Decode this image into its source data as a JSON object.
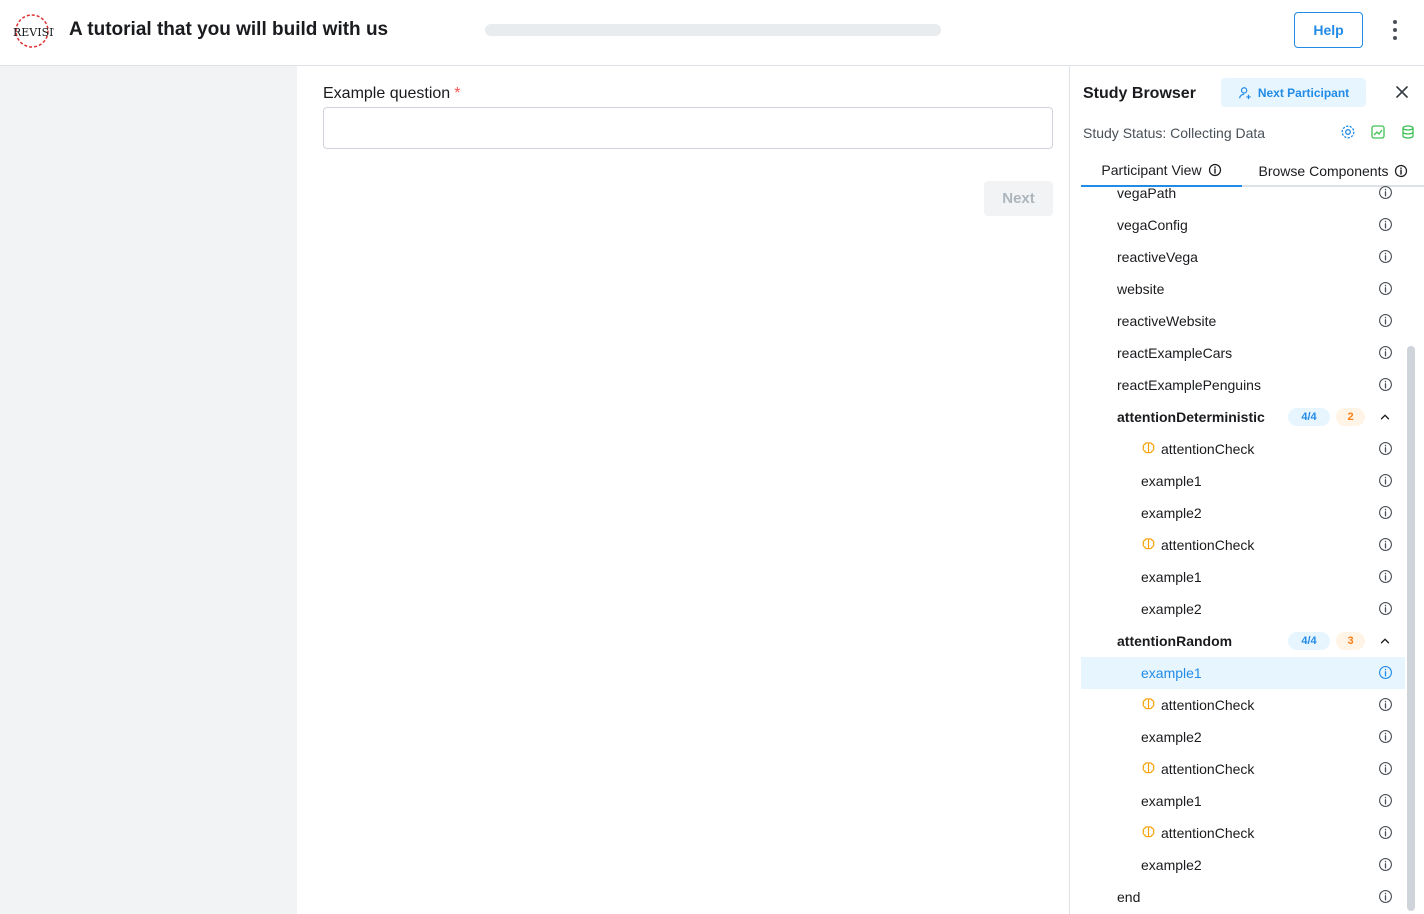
{
  "header": {
    "title": "A tutorial that you will build with us",
    "progress_percent": 0,
    "help_label": "Help"
  },
  "question": {
    "label": "Example question",
    "required_mark": "*",
    "value": "",
    "next_label": "Next"
  },
  "sidebar": {
    "title": "Study Browser",
    "next_participant_label": "Next Participant",
    "status_text": "Study Status: Collecting Data",
    "tabs": [
      {
        "label": "Participant View"
      },
      {
        "label": "Browse Components"
      }
    ],
    "tree": [
      {
        "label": "vegaPath",
        "level": 1
      },
      {
        "label": "vegaConfig",
        "level": 1
      },
      {
        "label": "reactiveVega",
        "level": 1
      },
      {
        "label": "website",
        "level": 1
      },
      {
        "label": "reactiveWebsite",
        "level": 1
      },
      {
        "label": "reactExampleCars",
        "level": 1
      },
      {
        "label": "reactExamplePenguins",
        "level": 1
      },
      {
        "label": "attentionDeterministic",
        "level": 1,
        "group": true,
        "badge_count": "4/4",
        "badge_order": "2"
      },
      {
        "label": "attentionCheck",
        "level": 2,
        "brain": true
      },
      {
        "label": "example1",
        "level": 2
      },
      {
        "label": "example2",
        "level": 2
      },
      {
        "label": "attentionCheck",
        "level": 2,
        "brain": true
      },
      {
        "label": "example1",
        "level": 2
      },
      {
        "label": "example2",
        "level": 2
      },
      {
        "label": "attentionRandom",
        "level": 1,
        "group": true,
        "badge_count": "4/4",
        "badge_order": "3"
      },
      {
        "label": "example1",
        "level": 2,
        "selected": true
      },
      {
        "label": "attentionCheck",
        "level": 2,
        "brain": true
      },
      {
        "label": "example2",
        "level": 2
      },
      {
        "label": "attentionCheck",
        "level": 2,
        "brain": true
      },
      {
        "label": "example1",
        "level": 2
      },
      {
        "label": "attentionCheck",
        "level": 2,
        "brain": true
      },
      {
        "label": "example2",
        "level": 2
      },
      {
        "label": "end",
        "level": 1
      }
    ]
  },
  "colors": {
    "accent": "#228be6",
    "required": "#fa5252",
    "brain_icon": "#f59f00",
    "badge_orange": "#fd7e14",
    "green_icons": "#40c057"
  },
  "icons": {
    "logo": "revisit-logo",
    "close": "close-icon",
    "status": [
      "gear-icon",
      "chart-icon",
      "database-icon"
    ],
    "tree_info": "info-icon",
    "attention": "brain-icon"
  }
}
